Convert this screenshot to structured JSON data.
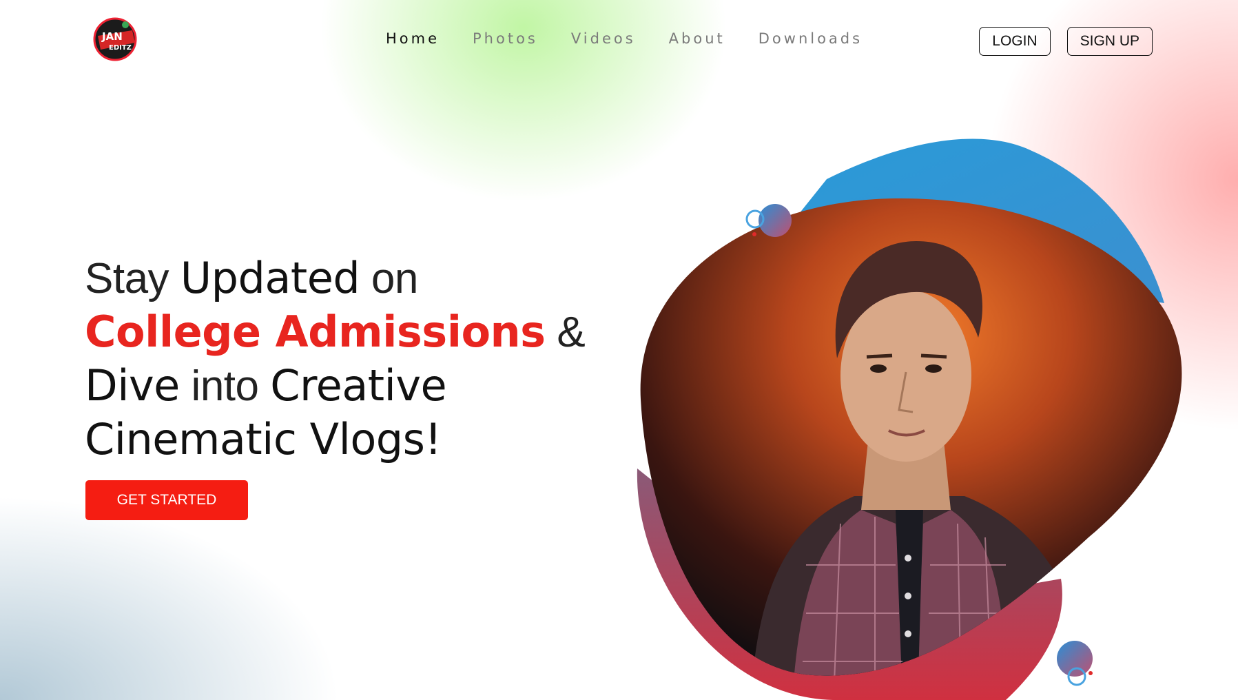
{
  "brand": {
    "logo_alt": "Jan Editz logo",
    "logo_text_top": "JAN",
    "logo_text_bottom": "EDITZ"
  },
  "nav": {
    "items": [
      {
        "label": "Home",
        "active": true
      },
      {
        "label": "Photos",
        "active": false
      },
      {
        "label": "Videos",
        "active": false
      },
      {
        "label": "About",
        "active": false
      },
      {
        "label": "Downloads",
        "active": false
      }
    ]
  },
  "auth": {
    "login_label": "LOGIN",
    "signup_label": "SIGN UP"
  },
  "hero": {
    "line1_a": "Stay ",
    "line1_b": "Updated",
    "line1_c": " on",
    "line2_a": "College Admissions",
    "line2_b": " &",
    "line3_a": "Dive",
    "line3_b": " into ",
    "line3_c": "Creative",
    "line4": "Cinematic Vlogs!",
    "cta_label": "GET STARTED"
  },
  "colors": {
    "accent": "#f51d12",
    "headline_red": "#e8251f",
    "blob_blue": "#2a9ad8",
    "blob_red": "#c8344a"
  },
  "icons": {
    "logo": "brand-logo-icon"
  }
}
